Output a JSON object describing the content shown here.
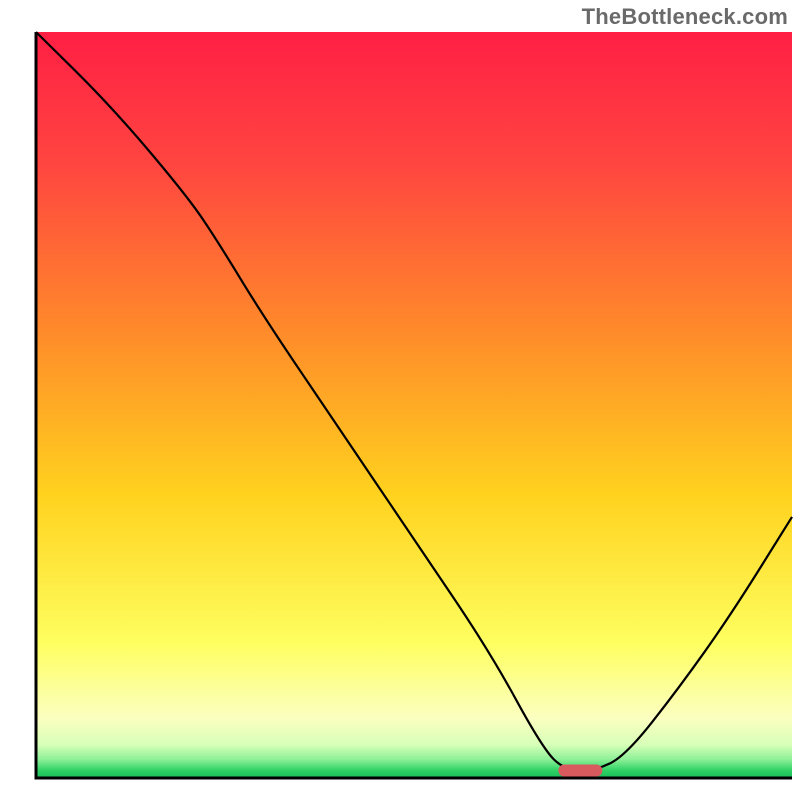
{
  "watermark": "TheBottleneck.com",
  "chart_data": {
    "type": "line",
    "title": "",
    "xlabel": "",
    "ylabel": "",
    "xlim": [
      0,
      100
    ],
    "ylim": [
      0,
      100
    ],
    "grid": false,
    "legend": false,
    "series": [
      {
        "name": "bottleneck-curve",
        "x": [
          0,
          10,
          20,
          24,
          30,
          40,
          50,
          60,
          67,
          70,
          74,
          78,
          85,
          92,
          100
        ],
        "values": [
          100,
          90,
          78,
          72,
          62,
          47,
          32,
          17,
          4,
          1,
          1,
          3,
          12,
          22,
          35
        ]
      }
    ],
    "marker": {
      "name": "optimal-marker",
      "x": 72,
      "y": 1,
      "color": "#d85a5f"
    },
    "background_gradient": {
      "description": "vertical gradient red→orange→yellow→pale-yellow with thin green band at bottom",
      "stops": [
        {
          "offset": 0.0,
          "color": "#ff1f44"
        },
        {
          "offset": 0.18,
          "color": "#ff4640"
        },
        {
          "offset": 0.4,
          "color": "#ff8a2a"
        },
        {
          "offset": 0.62,
          "color": "#ffd21e"
        },
        {
          "offset": 0.82,
          "color": "#feff60"
        },
        {
          "offset": 0.92,
          "color": "#fbffc0"
        },
        {
          "offset": 0.955,
          "color": "#d8ffb8"
        },
        {
          "offset": 0.975,
          "color": "#8ef098"
        },
        {
          "offset": 0.99,
          "color": "#2ed164"
        },
        {
          "offset": 1.0,
          "color": "#1abc5a"
        }
      ]
    },
    "axes_color": "#000000"
  }
}
